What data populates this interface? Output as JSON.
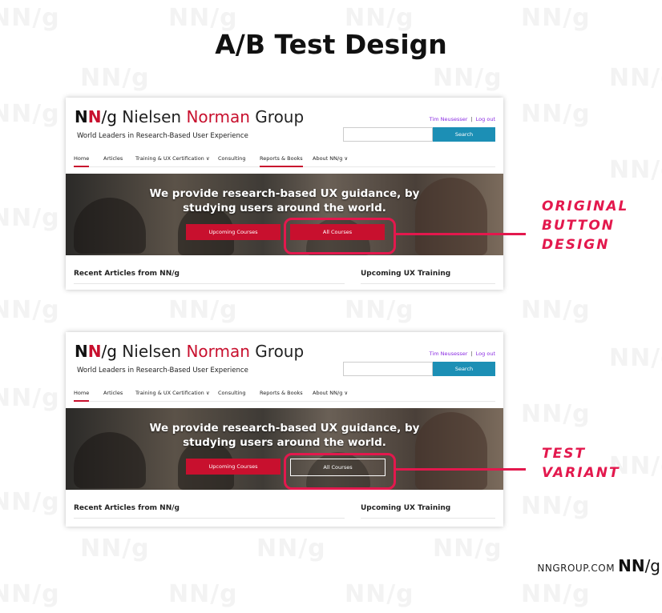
{
  "title": "A/B Test Design",
  "watermark_text": "NN/g",
  "accent_color": "#e3184d",
  "site": {
    "logo_nn_n1": "N",
    "logo_nn_n2": "N",
    "logo_nn_g": "/g",
    "logo_nielsen": "Nielsen",
    "logo_norman": "Norman",
    "logo_group": "Group",
    "tagline": "World Leaders in Research-Based User Experience",
    "user_name": "Tim Neusesser",
    "logout": "Log out",
    "search_button": "Search",
    "nav": [
      "Home",
      "Articles",
      "Training & UX Certification ∨",
      "Consulting",
      "Reports & Books",
      "About NN/g ∨"
    ],
    "hero_line1": "We provide research-based UX guidance, by",
    "hero_line2": "studying users around the world.",
    "btn_upcoming": "Upcoming Courses",
    "btn_all": "All Courses",
    "recent_articles": "Recent Articles from NN/g",
    "upcoming_training": "Upcoming UX Training"
  },
  "annotations": {
    "original": [
      "ORIGINAL",
      "BUTTON",
      "DESIGN"
    ],
    "variant": [
      "TEST",
      "VARIANT"
    ]
  },
  "footer": {
    "url": "NNGROUP.COM",
    "brand_nn": "NN",
    "brand_g": "/g"
  }
}
